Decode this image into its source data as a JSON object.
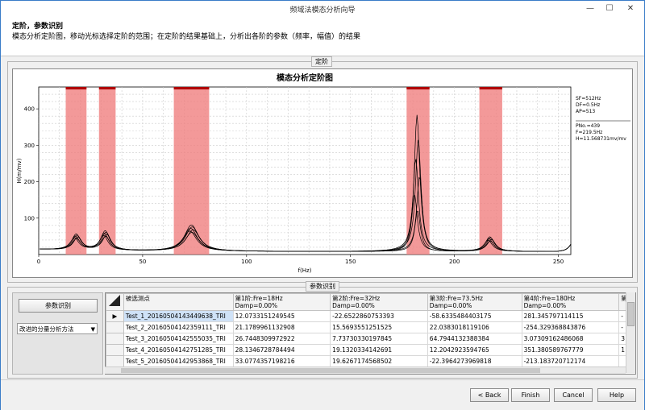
{
  "window": {
    "title": "频域法模态分析向导",
    "minimize": "—",
    "maximize": "☐",
    "close": "✕"
  },
  "header": {
    "title": "定阶，参数识别",
    "desc": "模态分析定阶图，移动光标选择定阶的范围；在定阶的结果基础上，分析出各阶的参数（频率，幅值）的结果"
  },
  "order_group": {
    "label": "定阶"
  },
  "param_group": {
    "label": "参数识别"
  },
  "chart_data": {
    "type": "line",
    "title": "模态分析定阶图",
    "xlabel": "f(Hz)",
    "ylabel": "H(m/mv)",
    "xlim": [
      0,
      256
    ],
    "ylim": [
      0,
      460
    ],
    "x_ticks": [
      0,
      50,
      100,
      150,
      200,
      250
    ],
    "y_ticks": [
      100,
      200,
      300,
      400
    ],
    "grid": true,
    "selected_bands": [
      [
        13,
        23
      ],
      [
        29,
        37
      ],
      [
        65,
        82
      ],
      [
        177,
        188
      ],
      [
        212,
        223
      ]
    ],
    "peaks": [
      {
        "freq": 18,
        "amplitude": 43
      },
      {
        "freq": 32,
        "amplitude": 53
      },
      {
        "freq": 73.5,
        "amplitude": 72
      },
      {
        "freq": 182,
        "amplitude": 375
      },
      {
        "freq": 217,
        "amplitude": 40
      }
    ],
    "info": {
      "line1": "SF=512Hz",
      "line2": "DF=0.5Hz",
      "line3": "AP=513",
      "line4": "PNo.=439",
      "line5": "F=219.5Hz",
      "line6": "H=11.568731mv/mv"
    }
  },
  "side": {
    "identify_button": "参数识别",
    "method_select": "改进的分量分析方法",
    "method_arrow": "▼"
  },
  "grid": {
    "corner_header": "被选测点",
    "columns": [
      {
        "label": "第1阶:Fre=18Hz\nDamp=0.00%"
      },
      {
        "label": "第2阶:Fre=32Hz\nDamp=0.00%"
      },
      {
        "label": "第3阶:Fre=73.5Hz\nDamp=0.00%"
      },
      {
        "label": "第4阶:Fre=180Hz\nDamp=0.00%"
      },
      {
        "label": "第"
      }
    ],
    "rows": [
      {
        "marker": "▶",
        "point": "Test_1_20160504143449638_TRI",
        "v1": "12.0733151249545",
        "v2": "-22.6522860753393",
        "v3": "-58.6335484403175",
        "v4": "281.345797114115",
        "v5": "-"
      },
      {
        "marker": "",
        "point": "Test_2_20160504142359111_TRI",
        "v1": "21.1789961132908",
        "v2": "15.5693551251525",
        "v3": "22.0383018119106",
        "v4": "-254.329368843876",
        "v5": "-"
      },
      {
        "marker": "",
        "point": "Test_3_20160504142555035_TRI",
        "v1": "26.7448309972922",
        "v2": "7.73730330197845",
        "v3": "64.7944132388384",
        "v4": "3.07309162486068",
        "v5": "3"
      },
      {
        "marker": "",
        "point": "Test_4_20160504142751285_TRI",
        "v1": "28.1346728784494",
        "v2": "19.1320334142691",
        "v3": "12.2042923594765",
        "v4": "351.380589767779",
        "v5": "1"
      },
      {
        "marker": "",
        "point": "Test_5_20160504142953868_TRI",
        "v1": "33.0774357198216",
        "v2": "19.6267174568502",
        "v3": "-22.3964273969818",
        "v4": "-213.183720712174",
        "v5": ""
      }
    ]
  },
  "footer": {
    "back": "< Back",
    "finish": "Finish",
    "cancel": "Cancel",
    "help": "Help"
  }
}
